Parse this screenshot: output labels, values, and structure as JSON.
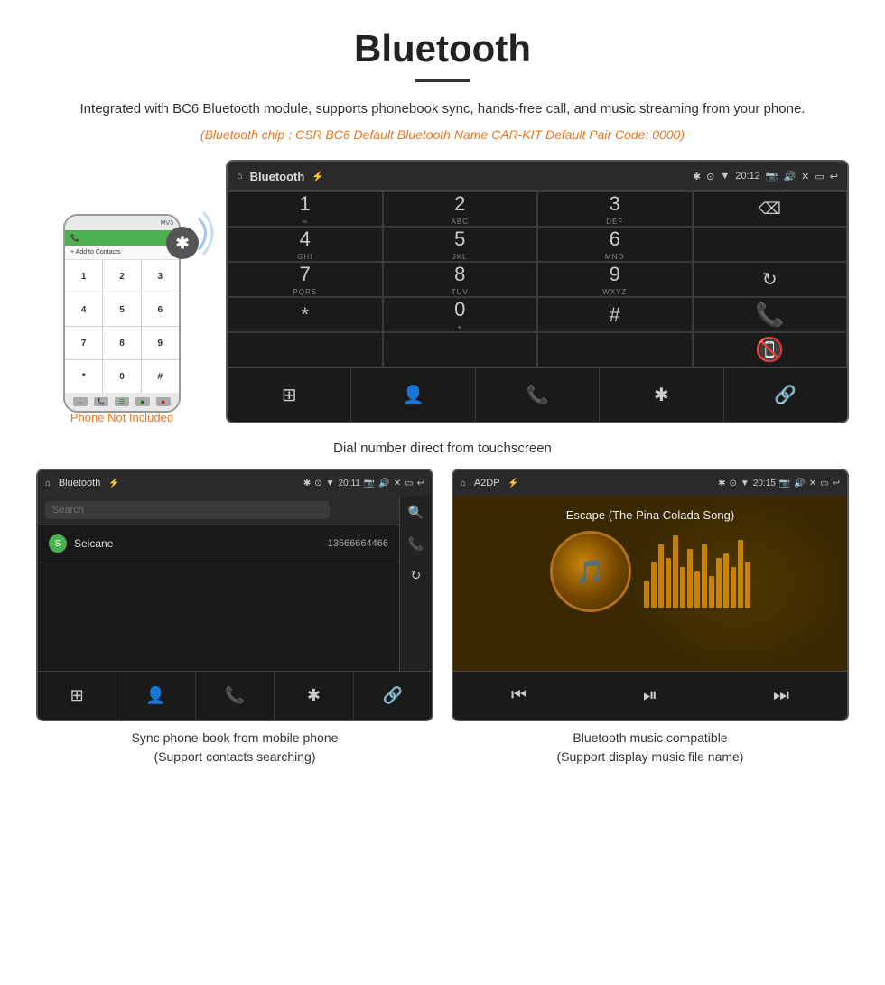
{
  "header": {
    "title": "Bluetooth",
    "underline": true,
    "description": "Integrated with BC6 Bluetooth module, supports phonebook sync, hands-free call, and music streaming from your phone.",
    "specs": "(Bluetooth chip : CSR BC6    Default Bluetooth Name CAR-KIT    Default Pair Code: 0000)"
  },
  "phone": {
    "note": "Phone Not Included",
    "contact_banner": "+ Add to Contacts",
    "keys": [
      "1",
      "2",
      "3",
      "4",
      "5",
      "6",
      "7",
      "8",
      "9",
      "*",
      "0",
      "#"
    ]
  },
  "dial_screen": {
    "title": "Bluetooth",
    "time": "20:12",
    "keys": [
      {
        "main": "1",
        "sub": ""
      },
      {
        "main": "2",
        "sub": "ABC"
      },
      {
        "main": "3",
        "sub": "DEF"
      },
      {
        "main": "⌫",
        "sub": ""
      },
      {
        "main": "4",
        "sub": "GHI"
      },
      {
        "main": "5",
        "sub": "JKL"
      },
      {
        "main": "6",
        "sub": "MNO"
      },
      {
        "main": "",
        "sub": ""
      },
      {
        "main": "7",
        "sub": "PQRS"
      },
      {
        "main": "8",
        "sub": "TUV"
      },
      {
        "main": "9",
        "sub": "WXYZ"
      },
      {
        "main": "↻",
        "sub": ""
      },
      {
        "main": "*",
        "sub": ""
      },
      {
        "main": "0",
        "sub": "+"
      },
      {
        "main": "#",
        "sub": ""
      },
      {
        "main": "📞",
        "sub": "call"
      },
      {
        "main": "📵",
        "sub": "end"
      }
    ],
    "bottom_icons": [
      "⊞",
      "👤",
      "📞",
      "✱",
      "🔗"
    ]
  },
  "main_caption": "Dial number direct from touchscreen",
  "phonebook_screen": {
    "title": "Bluetooth",
    "time": "20:11",
    "search_placeholder": "Search",
    "contacts": [
      {
        "letter": "S",
        "name": "Seicane",
        "number": "13566664466"
      }
    ],
    "side_icons": [
      "🔍",
      "📞",
      "↻"
    ],
    "bottom_icons": [
      "⊞",
      "👤",
      "📞",
      "✱",
      "🔗"
    ]
  },
  "phonebook_caption": "Sync phone-book from mobile phone\n(Support contacts searching)",
  "music_screen": {
    "title": "A2DP",
    "time": "20:15",
    "song_title": "Escape (The Pina Colada Song)",
    "eq_bars": [
      30,
      50,
      70,
      55,
      80,
      45,
      65,
      40,
      70,
      35,
      55,
      60,
      45,
      75,
      50
    ]
  },
  "music_caption": "Bluetooth music compatible\n(Support display music file name)"
}
